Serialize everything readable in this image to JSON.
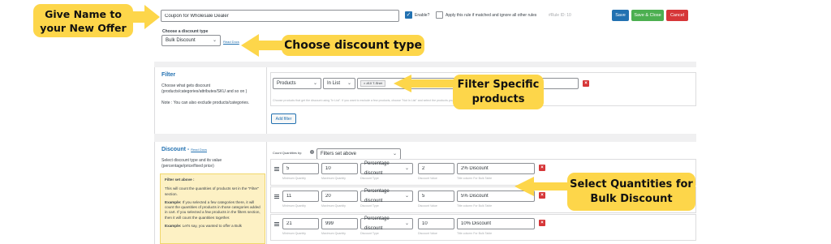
{
  "offer": {
    "name_value": "Coupon for Wholesale Dealer",
    "enable_label": "Enable?",
    "apply_rule_label": "Apply this rule if matched and ignore all other rules",
    "rule_id_label": "#Rule ID: 10",
    "save_label": "Save",
    "save_close_label": "Save & Close",
    "cancel_label": "Cancel"
  },
  "discount_type": {
    "label": "Choose a discount type",
    "value": "Bulk Discount",
    "read_docs": "Read Docs"
  },
  "filter": {
    "title": "Filter",
    "desc_1": "Choose what gets discount",
    "desc_2": "(products/categories/attributes/SKU and so on )",
    "note": "Note : You can also exclude products/categories.",
    "type_value": "Products",
    "condition_value": "In List",
    "chip_value": "× #10 T-Shirt",
    "hint": "Choose products that get the discount using \"In List\". If you want to exclude a few products, choose \"Not In List\" and select the products you wanted to exclude from discount. (You can add multiple filters)",
    "add_filter_label": "Add filter"
  },
  "discount": {
    "title": "Discount - ",
    "read_docs": "Read Docs",
    "desc_1": "Select discount type and its value",
    "desc_2": "(percentage/price/fixed price)",
    "count_label": "Count Quantities by:",
    "count_value": "Filters set above",
    "help": {
      "title": "Filter set above :",
      "p1": "This will count the quantities of products set in the \"Filter\" section.",
      "example_label": "Example:",
      "p2": "If you selected a few categories there, it will count the quantities of products in those categories added in cart. If you selected a few products in the filters section, then it will count the quantities together.",
      "p3": "Let's say, you wanted to offer a Bulk"
    },
    "labels": {
      "min": "Minimum Quantity",
      "max": "Maximum Quantity",
      "type": "Discount Type",
      "value": "Discount Value",
      "title": "Title column For Bulk Table"
    },
    "rows": [
      {
        "min": "5",
        "max": "10",
        "type": "Percentage discount",
        "value": "2",
        "title": "2% Discount"
      },
      {
        "min": "11",
        "max": "20",
        "type": "Percentage discount",
        "value": "5",
        "title": "5% Discount"
      },
      {
        "min": "21",
        "max": "999",
        "type": "Percentage discount",
        "value": "10",
        "title": "10% Discount"
      }
    ]
  },
  "callouts": {
    "name": "Give Name to your New Offer",
    "discount_type": "Choose discount type",
    "filter": "Filter Specific products",
    "quantities": "Select Quantities for Bulk Discount"
  },
  "colors": {
    "callout": "#fdd64a",
    "primary": "#2271b1",
    "save_close": "#4caf50",
    "cancel": "#d63638",
    "help_box": "#fdf1c4"
  }
}
